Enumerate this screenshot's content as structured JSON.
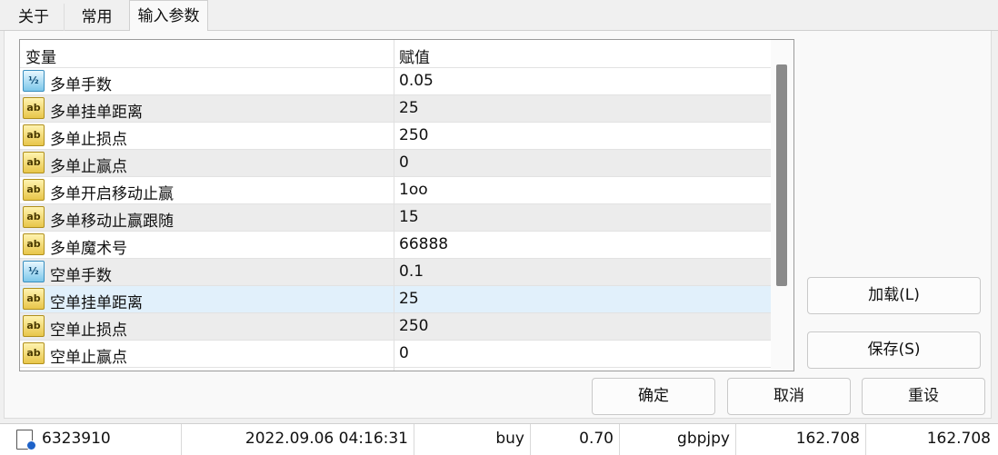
{
  "tabs": [
    {
      "label": "关于"
    },
    {
      "label": "常用"
    },
    {
      "label": "输入参数"
    }
  ],
  "grid": {
    "header": {
      "variable": "变量",
      "value": "赋值"
    },
    "rows": [
      {
        "icon": "half-icon",
        "name": "多单手数",
        "value": "0.05"
      },
      {
        "icon": "ab-icon",
        "name": "多单挂单距离",
        "value": "25"
      },
      {
        "icon": "ab-icon",
        "name": "多单止损点",
        "value": "250"
      },
      {
        "icon": "ab-icon",
        "name": "多单止赢点",
        "value": "0"
      },
      {
        "icon": "ab-icon",
        "name": "多单开启移动止赢",
        "value": "1oo"
      },
      {
        "icon": "ab-icon",
        "name": "多单移动止赢跟随",
        "value": "15"
      },
      {
        "icon": "ab-icon",
        "name": "多单魔术号",
        "value": "66888"
      },
      {
        "icon": "half-icon",
        "name": "空单手数",
        "value": "0.1"
      },
      {
        "icon": "ab-icon",
        "name": "空单挂单距离",
        "value": "25"
      },
      {
        "icon": "ab-icon",
        "name": "空单止损点",
        "value": "250"
      },
      {
        "icon": "ab-icon",
        "name": "空单止赢点",
        "value": "0"
      }
    ],
    "icon_text": {
      "ab": "ab",
      "half": "½"
    }
  },
  "buttons": {
    "load": "加载(L)",
    "save": "保存(S)",
    "ok": "确定",
    "cancel": "取消",
    "reset": "重设"
  },
  "bottom_row": {
    "ticket": "6323910",
    "time": "2022.09.06 04:16:31",
    "type": "buy",
    "size": "0.70",
    "symbol": "gbpjpy",
    "price": "162.708",
    "price2": "162.708"
  },
  "colors": {
    "selected_row": "#e1f0fb",
    "alt_row": "#ececec"
  }
}
